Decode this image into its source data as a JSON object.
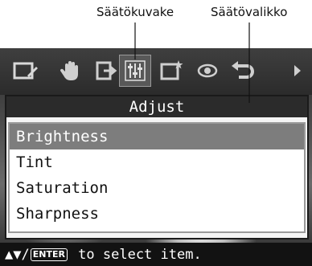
{
  "callouts": {
    "icon_label": "Säätökuvake",
    "menu_label": "Säätövalikko"
  },
  "toolbar": {
    "tools": [
      {
        "icon": "edit-frame-icon"
      },
      {
        "icon": "hand-icon"
      },
      {
        "icon": "export-icon"
      },
      {
        "icon": "adjust-sliders-icon",
        "selected": true
      },
      {
        "icon": "add-frame-icon"
      },
      {
        "icon": "red-eye-icon"
      },
      {
        "icon": "undo-icon"
      }
    ]
  },
  "panel": {
    "title": "Adjust",
    "items": [
      "Brightness",
      "Tint",
      "Saturation",
      "Sharpness"
    ],
    "selected_index": 0
  },
  "status": {
    "arrows": "▲▼/",
    "key": "ENTER",
    "text": " to select item."
  }
}
